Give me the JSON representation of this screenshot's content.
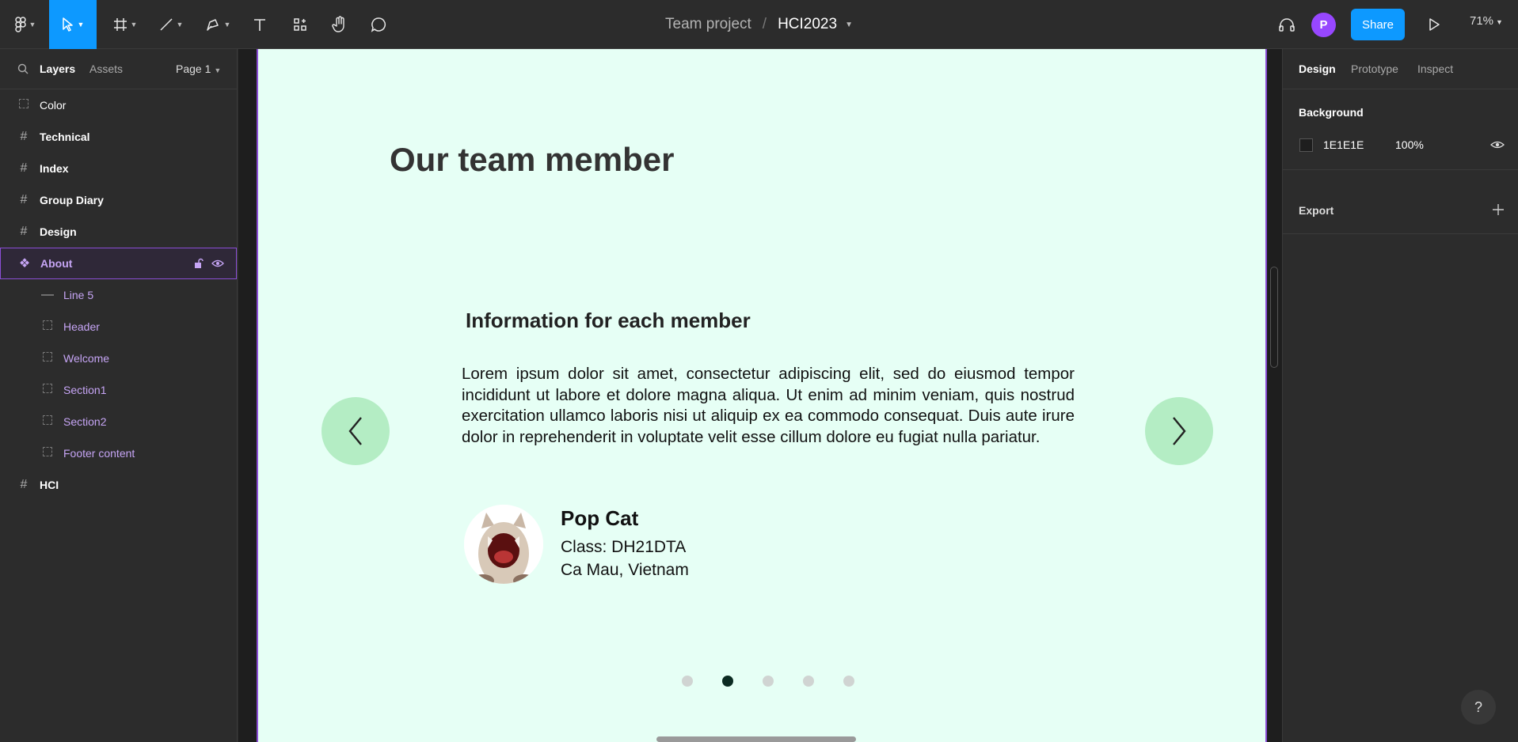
{
  "toolbar": {
    "project": "Team project",
    "separator": "/",
    "file_name": "HCI2023",
    "avatar_initial": "P",
    "share_label": "Share",
    "zoom": "71%"
  },
  "left_panel": {
    "tabs": {
      "layers": "Layers",
      "assets": "Assets",
      "page": "Page 1"
    },
    "layers": [
      {
        "label": "Color",
        "icon": "dashed-frame-icon",
        "child": false
      },
      {
        "label": "Technical",
        "icon": "frame-icon",
        "child": false
      },
      {
        "label": "Index",
        "icon": "frame-icon",
        "child": false
      },
      {
        "label": "Group Diary",
        "icon": "frame-icon",
        "child": false
      },
      {
        "label": "Design",
        "icon": "frame-icon",
        "child": false
      },
      {
        "label": "About",
        "icon": "component-icon",
        "child": false,
        "selected": true
      },
      {
        "label": "Line 5",
        "icon": "line-icon",
        "child": true
      },
      {
        "label": "Header",
        "icon": "dashed-frame-icon",
        "child": true
      },
      {
        "label": "Welcome",
        "icon": "dashed-frame-icon",
        "child": true
      },
      {
        "label": "Section1",
        "icon": "dashed-frame-icon",
        "child": true
      },
      {
        "label": "Section2",
        "icon": "dashed-frame-icon",
        "child": true
      },
      {
        "label": "Footer content",
        "icon": "dashed-frame-icon",
        "child": true
      },
      {
        "label": "HCI",
        "icon": "frame-icon",
        "child": false
      }
    ]
  },
  "canvas": {
    "frame_title": "Our team member",
    "info_title": "Information for each member",
    "info_text": "Lorem ipsum dolor sit amet, consectetur adipiscing elit, sed do eiusmod tempor incididunt ut labore et dolore magna aliqua. Ut enim ad minim veniam, quis nostrud exercitation ullamco laboris nisi ut aliquip ex ea commodo consequat. Duis aute irure dolor in reprehenderit in voluptate velit esse cillum dolore eu fugiat nulla pariatur.",
    "member": {
      "name": "Pop Cat",
      "class": "Class: DH21DTA",
      "location": "Ca Mau, Vietnam"
    },
    "pagination": {
      "count": 5,
      "active_index": 1
    },
    "frame_background": "#e6fff5",
    "nav_button_color": "#b4edc4"
  },
  "right_panel": {
    "tabs": {
      "design": "Design",
      "prototype": "Prototype",
      "inspect": "Inspect"
    },
    "background": {
      "title": "Background",
      "hex": "1E1E1E",
      "opacity": "100%"
    },
    "export": {
      "title": "Export"
    }
  },
  "help_label": "?"
}
